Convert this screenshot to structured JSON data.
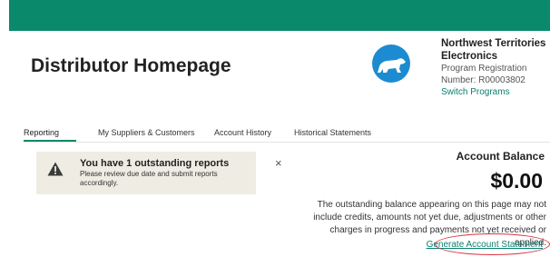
{
  "header": {
    "title": "Distributor Homepage",
    "org_name": "Northwest Territories Electronics",
    "program_label": "Program Registration",
    "registration_number": "Number: R00003802",
    "switch_label": "Switch Programs"
  },
  "tabs": [
    {
      "label": "Reporting",
      "active": true
    },
    {
      "label": "My Suppliers & Customers"
    },
    {
      "label": "Account History"
    },
    {
      "label": "Historical Statements"
    }
  ],
  "alert": {
    "title": "You have 1 outstanding reports",
    "body": "Please review due date and submit reports accordingly.",
    "close_glyph": "×"
  },
  "balance": {
    "heading": "Account Balance",
    "amount": "$0.00",
    "note": "The outstanding balance appearing on this page may not include credits, amounts not yet due, adjustments or other charges in progress and payments not yet received or applied.",
    "generate_label": "Generate Account Statement"
  },
  "colors": {
    "brand": "#0a8a6b",
    "link": "#0a7f6f",
    "logo_bg": "#1d8bd1",
    "alert_bg": "#efece3",
    "highlight": "#d9323e"
  },
  "icons": {
    "logo": "polar-bear-logo",
    "alert": "warning-triangle-icon",
    "close": "close-icon"
  }
}
